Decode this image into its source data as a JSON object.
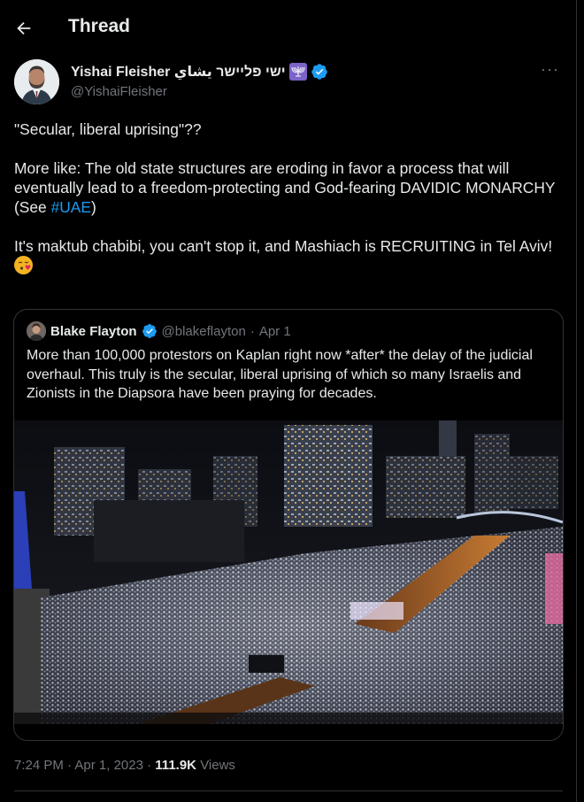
{
  "header": {
    "title": "Thread",
    "back_icon": "arrow-left-icon"
  },
  "author": {
    "name": "Yishai Fleisher ישי פליישר يشاي",
    "emoji_badge": "🕎",
    "verified": true,
    "handle": "@YishaiFleisher"
  },
  "tweet": {
    "line1": "\"Secular, liberal uprising\"??",
    "para2": "More like: The old state structures are eroding in favor a process that will eventually lead to a freedom-protecting and God-fearing DAVIDIC MONARCHY",
    "see_prefix": "(See ",
    "hashtag": "#UAE",
    "see_suffix": ")",
    "para3": "It's maktub chabibi, you can't stop it, and Mashiach is RECRUITING in Tel Aviv!"
  },
  "quote": {
    "name": "Blake Flayton",
    "handle": "@blakeflayton",
    "separator": "·",
    "date": "Apr 1",
    "text": "More than 100,000 protestors on Kaplan right now *after* the delay of the judicial overhaul. This truly is the secular, liberal uprising of which so many Israelis and Zionists in the Diapsora have been praying for decades."
  },
  "meta": {
    "time": "7:24 PM",
    "dot1": "·",
    "date": "Apr 1, 2023",
    "dot2": "·",
    "views_count": "111.9K",
    "views_label": "Views"
  },
  "colors": {
    "accent": "#1d9bf0",
    "background": "#000000",
    "muted": "#71767b",
    "border": "#2f3336"
  }
}
